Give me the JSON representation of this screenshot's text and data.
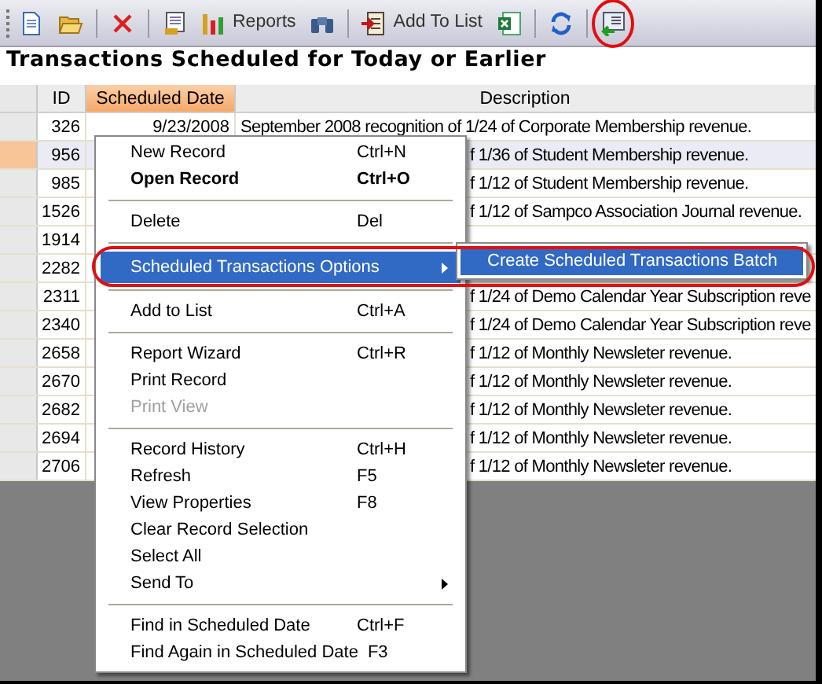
{
  "toolbar": [
    {
      "kind": "button"
    },
    {
      "kind": "button"
    },
    {
      "kind": "separator"
    },
    {
      "kind": "button"
    },
    {
      "kind": "separator"
    },
    {
      "kind": "button"
    },
    {
      "kind": "button",
      "label": "Reports"
    },
    {
      "kind": "button"
    },
    {
      "kind": "separator"
    },
    {
      "kind": "button",
      "label": "Add To List"
    },
    {
      "kind": "button"
    },
    {
      "kind": "separator"
    },
    {
      "kind": "button"
    },
    {
      "kind": "separator"
    },
    {
      "kind": "button",
      "circled": true
    }
  ],
  "title": "Transactions Scheduled for Today or Earlier",
  "table": {
    "columns": [
      {
        "label": "ID",
        "sorted": false
      },
      {
        "label": "Scheduled Date",
        "sorted": true
      },
      {
        "label": "Description",
        "sorted": false
      }
    ],
    "rows": [
      {
        "id": "326",
        "date": "9/23/2008",
        "description": "September 2008 recognition of 1/24 of Corporate Membership revenue.",
        "selected": false
      },
      {
        "id": "956",
        "description": "f 1/36 of Student Membership revenue.",
        "selected": true
      },
      {
        "id": "985",
        "description": "f 1/12 of Student Membership revenue.",
        "selected": false
      },
      {
        "id": "1526",
        "description": "f 1/12 of Sampco Association Journal revenue.",
        "selected": false
      },
      {
        "id": "1914",
        "selected": false
      },
      {
        "id": "2282",
        "selected": false
      },
      {
        "id": "2311",
        "description": "f 1/24 of Demo Calendar Year Subscription reve",
        "selected": false
      },
      {
        "id": "2340",
        "description": "f 1/24 of Demo Calendar Year Subscription reve",
        "selected": false
      },
      {
        "id": "2658",
        "description": "f 1/12 of Monthly Newsleter revenue.",
        "selected": false
      },
      {
        "id": "2670",
        "description": "f 1/12 of Monthly Newsleter revenue.",
        "selected": false
      },
      {
        "id": "2682",
        "description": "f 1/12 of Monthly Newsleter revenue.",
        "selected": false
      },
      {
        "id": "2694",
        "description": "f 1/12 of Monthly Newsleter revenue.",
        "selected": false
      },
      {
        "id": "2706",
        "description": "f 1/12 of Monthly Newsleter revenue.",
        "selected": false
      }
    ]
  },
  "context_menu": [
    {
      "kind": "item",
      "label": "New Record",
      "shortcut": "Ctrl+N"
    },
    {
      "kind": "item",
      "label": "Open Record",
      "shortcut": "Ctrl+O",
      "bold": true
    },
    {
      "kind": "separator"
    },
    {
      "kind": "item",
      "label": "Delete",
      "shortcut": "Del"
    },
    {
      "kind": "separator"
    },
    {
      "kind": "item",
      "label": "Scheduled Transactions Options",
      "has_submenu": true,
      "selected": true,
      "circled": true
    },
    {
      "kind": "separator"
    },
    {
      "kind": "item",
      "label": "Add to List",
      "shortcut": "Ctrl+A"
    },
    {
      "kind": "separator"
    },
    {
      "kind": "item",
      "label": "Report Wizard",
      "shortcut": "Ctrl+R"
    },
    {
      "kind": "item",
      "label": "Print Record"
    },
    {
      "kind": "item",
      "label": "Print View",
      "disabled": true
    },
    {
      "kind": "separator"
    },
    {
      "kind": "item",
      "label": "Record History",
      "shortcut": "Ctrl+H"
    },
    {
      "kind": "item",
      "label": "Refresh",
      "shortcut": "F5"
    },
    {
      "kind": "item",
      "label": "View Properties",
      "shortcut": "F8"
    },
    {
      "kind": "item",
      "label": "Clear Record Selection"
    },
    {
      "kind": "item",
      "label": "Select All"
    },
    {
      "kind": "item",
      "label": "Send To",
      "has_submenu": true
    },
    {
      "kind": "separator"
    },
    {
      "kind": "item",
      "label": "Find in Scheduled Date",
      "shortcut": "Ctrl+F"
    },
    {
      "kind": "item",
      "label": "Find Again in Scheduled Date",
      "shortcut": "F3"
    }
  ],
  "submenu": [
    {
      "label": "Create Scheduled Transactions Batch",
      "selected": true
    }
  ]
}
